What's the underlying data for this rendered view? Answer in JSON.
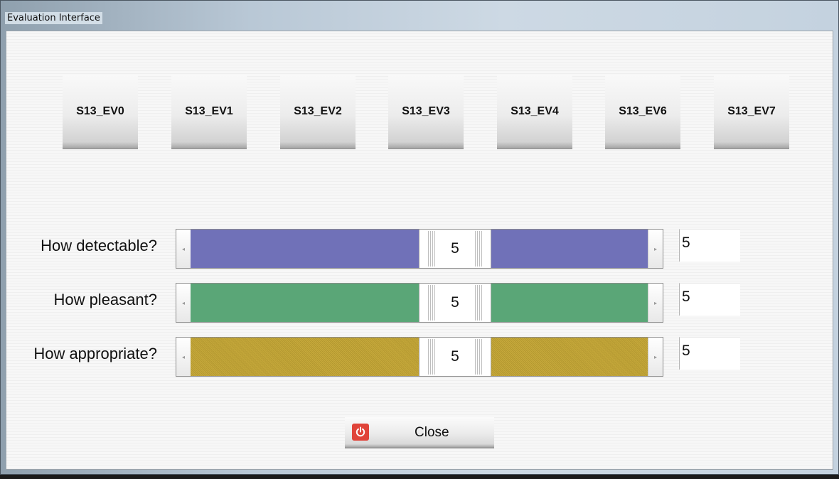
{
  "window": {
    "title": "Evaluation Interface"
  },
  "ev_buttons": [
    {
      "label": "S13_EV0"
    },
    {
      "label": "S13_EV1"
    },
    {
      "label": "S13_EV2"
    },
    {
      "label": "S13_EV3"
    },
    {
      "label": "S13_EV4"
    },
    {
      "label": "S13_EV6"
    },
    {
      "label": "S13_EV7"
    }
  ],
  "sliders": [
    {
      "label": "How detectable?",
      "value": "5",
      "field_value": "5",
      "color": "#7071b8",
      "position_fraction": 0.5
    },
    {
      "label": "How pleasant?",
      "value": "5",
      "field_value": "5",
      "color": "#5aa677",
      "position_fraction": 0.5
    },
    {
      "label": "How appropriate?",
      "value": "5",
      "field_value": "5",
      "color": "#c8aa3c",
      "position_fraction": 0.5
    }
  ],
  "close_button": {
    "label": "Close",
    "icon": "power-icon",
    "icon_color": "#e0443a"
  }
}
